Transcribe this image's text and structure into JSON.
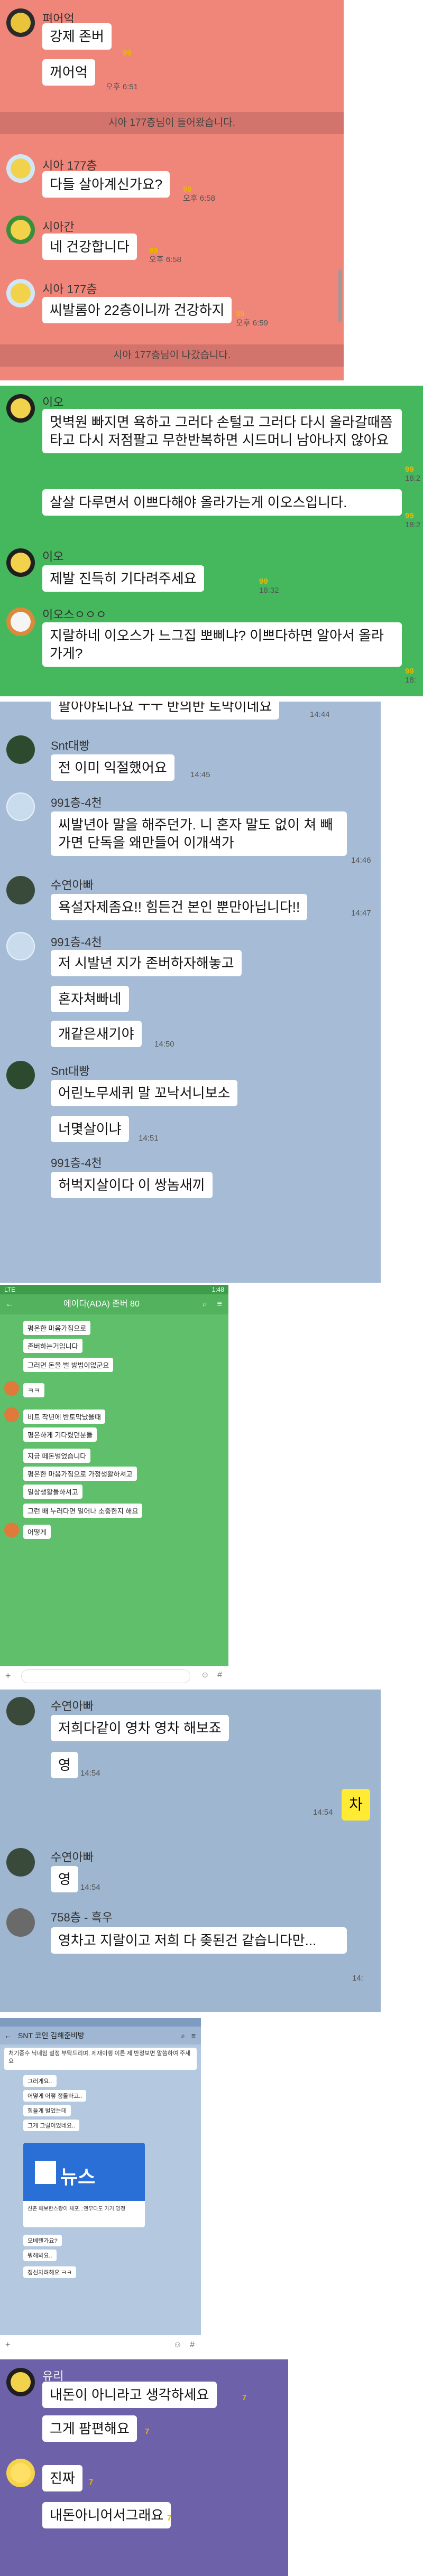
{
  "colors": {
    "pink": "#f0857a",
    "green": "#45b85e",
    "blue": "#a6bcd6",
    "purple": "#6d61a9",
    "count_yellow": "#e8b800"
  },
  "panel1": {
    "messages": [
      {
        "sender": "펴어억",
        "text": "강제 존버",
        "count": "",
        "time": ""
      },
      {
        "text": "꺼어억",
        "count": "",
        "time": "오후 6:51"
      },
      {
        "sender": "시아 177층",
        "text": "다들 살아계신가요?",
        "count": "",
        "time": "오후 6:58"
      },
      {
        "sender": "시아간",
        "text": "네 건강합니다",
        "count": "",
        "time": "오후 6:58"
      },
      {
        "sender": "시아 177층",
        "text": "씨발롬아 22층이니까 건강하지",
        "count": "",
        "time": "오후 6:59"
      }
    ],
    "count_small": "99",
    "notice_in": "시아 177층님이 들어왔습니다.",
    "notice_out": "시아 177층님이 나갔습니다."
  },
  "panel2": {
    "messages": [
      {
        "sender": "이오",
        "text": "멋벽원 빠지면 욕하고 그러다 손털고 그러다 다시 올라갈때쯤 타고 다시 저점팔고 무한반복하면 시드머니 남아나지 않아요",
        "count": "99",
        "time": "18:2"
      },
      {
        "text": "살살 다루면서 이쁘다해야 올라가는게 이오스입니다.",
        "count": "99",
        "time": "18:2"
      },
      {
        "sender": "이오",
        "text": "제발 진득히 기다려주세요",
        "count": "99",
        "time": "18:32"
      },
      {
        "sender": "이오스ㅇㅇㅇ",
        "text": "지랄하네 이오스가 느그집 뽀삐냐? 이쁘다하면 알아서 올라가게?",
        "count": "99",
        "time": "18:"
      }
    ]
  },
  "panel3": {
    "top_cut": "팔아야되나요 ㅜㅜ 반의반 토막이네요",
    "top_time": "14:44",
    "messages": [
      {
        "sender": "Snt대빵",
        "text": "전 이미 익절했어요",
        "time": "14:45"
      },
      {
        "sender": "991층-4천",
        "text": "씨발년아 말을 해주던가. 니 혼자 말도 없이 쳐 빼가면 단독을 왜만들어 이개색가",
        "time": "14:46"
      },
      {
        "sender": "수연아빠",
        "text": "욕설자제좀요!! 힘든건 본인 뿐만아닙니다!!",
        "time": "14:47"
      },
      {
        "sender": "991층-4천",
        "text": "저 시발년 지가 존버하자해놓고",
        "time": ""
      },
      {
        "text": "혼자쳐빠네",
        "time": ""
      },
      {
        "text": "개같은새기야",
        "time": "14:50"
      },
      {
        "sender": "Snt대빵",
        "text": "어린노무세퀴 말 꼬낙서니보소",
        "time": ""
      },
      {
        "text": "너몇살이냐",
        "time": "14:51"
      },
      {
        "sender": "991층-4천",
        "text": "허벅지살이다 이 쌍놈새끼",
        "time": ""
      }
    ]
  },
  "panel4": {
    "status_left": "LTE",
    "status_right": "1:48",
    "title": "에이다(ADA) 존버 80",
    "messages": [
      {
        "text": "평온한 마음가짐으로",
        "sender": ""
      },
      {
        "text": "존버하는거입니다",
        "sender": ""
      },
      {
        "text": "그러면 돈을 벌 방법이없군요",
        "sender": ""
      },
      {
        "text": "ㅋㅋ",
        "sender": ""
      },
      {
        "text": "비트 작년에 반토막났을때",
        "sender": ""
      },
      {
        "text": "평온하게 기다렸던분들",
        "sender": ""
      },
      {
        "text": "지금 떼돈벌었습니다",
        "sender": ""
      },
      {
        "text": "평온한 마음가짐으로 가정생활하셔고",
        "sender": ""
      },
      {
        "text": "일상생활들하셔고",
        "sender": ""
      },
      {
        "text": "그런 배 누러다면 일어나 소중한지 해요",
        "sender": ""
      },
      {
        "text": "어떻게",
        "sender": ""
      }
    ],
    "input_placeholder": ""
  },
  "panel5": {
    "messages": [
      {
        "sender": "수연아빠",
        "text": "저희다같이 영차 영차 해보죠",
        "time": ""
      },
      {
        "text": "영",
        "time": "14:54"
      },
      {
        "mine": "차",
        "time": "14:54"
      },
      {
        "sender": "수연아빠",
        "text": "영",
        "time": "14:54"
      },
      {
        "sender": "758층 - 흑우",
        "text": "영차고 지랄이고 저희 다 좆된건 같습니다만...",
        "time": "14:"
      }
    ]
  },
  "panel6": {
    "title": "SNT 코인 김해준비방",
    "banner": "처기중수 닉네임 설정 부탁드리며, 제재이행 이른 제 반정보면 말씀하여 주세요",
    "messages": [
      {
        "text": "그러게요.."
      },
      {
        "text": "어떻게 어떻 정돌하고.."
      },
      {
        "text": "힘들게 벌었는데"
      },
      {
        "text": "그게 그럴이었네요.."
      },
      {
        "card_logo": "뉴스",
        "card_text": "신촌 에보한스랑이 체포...엔무다도 가거 영정"
      },
      {
        "text": "오베텐가요?"
      },
      {
        "text": "뭐해봐요.."
      },
      {
        "text": "정신차려해요 ㅋㅋ"
      }
    ]
  },
  "panel7": {
    "messages": [
      {
        "sender": "유리",
        "text": "내돈이 아니라고 생각하세요",
        "count": "7"
      },
      {
        "text": "그게 팜편해요",
        "count": "7"
      },
      {
        "text": "진짜",
        "count": "7"
      },
      {
        "text": "내돈아니어서그래요",
        "count": "7"
      }
    ]
  }
}
